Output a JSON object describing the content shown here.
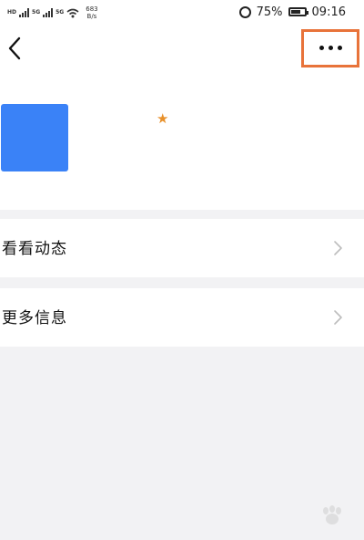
{
  "status_bar": {
    "left_sig1": "HD",
    "left_sig2": "5G",
    "left_sig3": "5G",
    "net_speed": "683",
    "net_unit": "B/s",
    "battery": "75%",
    "battery_level": 0.75,
    "time": "09:16"
  },
  "nav": {
    "back_icon": "chevron-left-icon",
    "more_icon": "more-dots-icon",
    "highlight_color": "#e8733a"
  },
  "profile": {
    "avatar_color": "#3a82f7",
    "star_glyph": "★",
    "star_color": "#e8912b"
  },
  "menu": {
    "items": [
      {
        "label": "看看动态"
      },
      {
        "label": "更多信息"
      }
    ]
  }
}
